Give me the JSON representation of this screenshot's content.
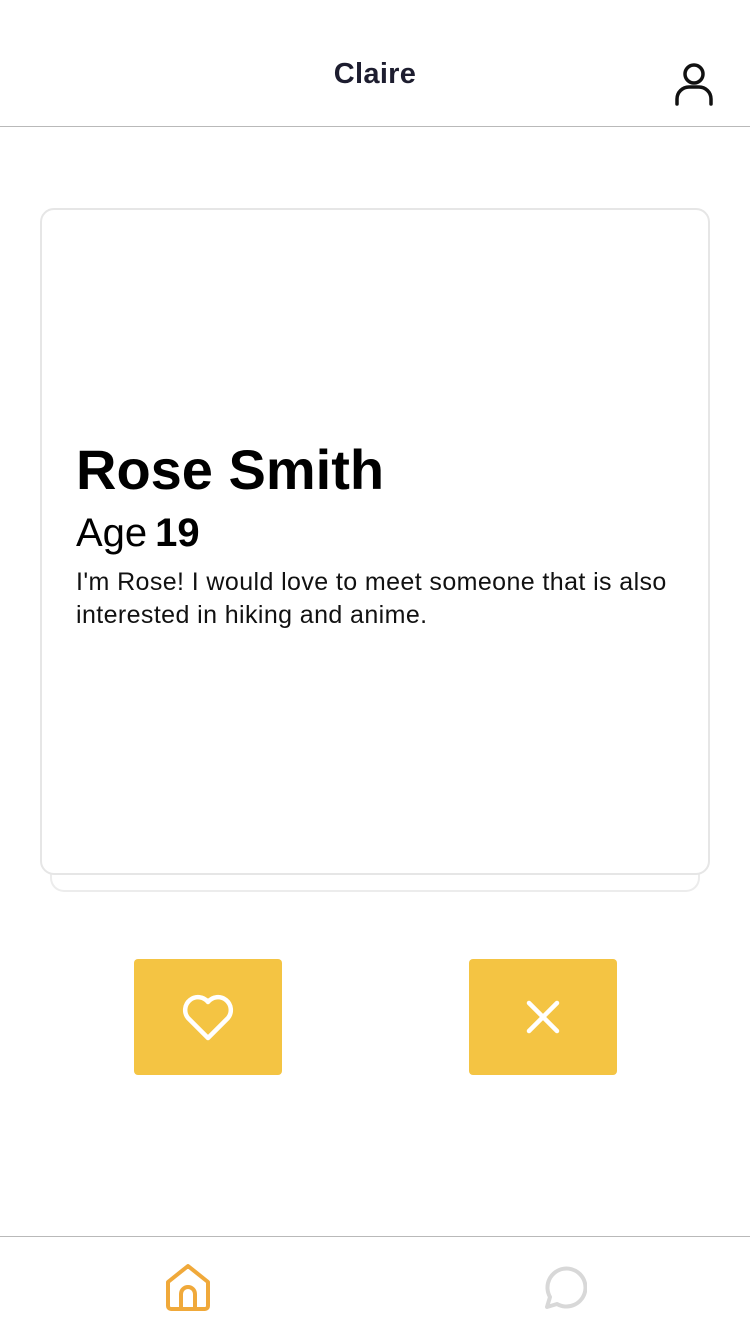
{
  "header": {
    "title": "Claire",
    "profile_icon": "user-icon"
  },
  "card": {
    "name": "Rose Smith",
    "age_label": "Age",
    "age_value": "19",
    "bio": "I'm Rose! I would love to meet someone that is also interested in hiking and anime."
  },
  "actions": {
    "like_icon": "heart-icon",
    "pass_icon": "close-icon",
    "button_color": "#f4c443"
  },
  "bottom_nav": {
    "items": [
      {
        "icon": "home-icon",
        "active": true,
        "color": "#f0a93a"
      },
      {
        "icon": "chat-icon",
        "active": false,
        "color": "#d8d8d8"
      }
    ]
  }
}
